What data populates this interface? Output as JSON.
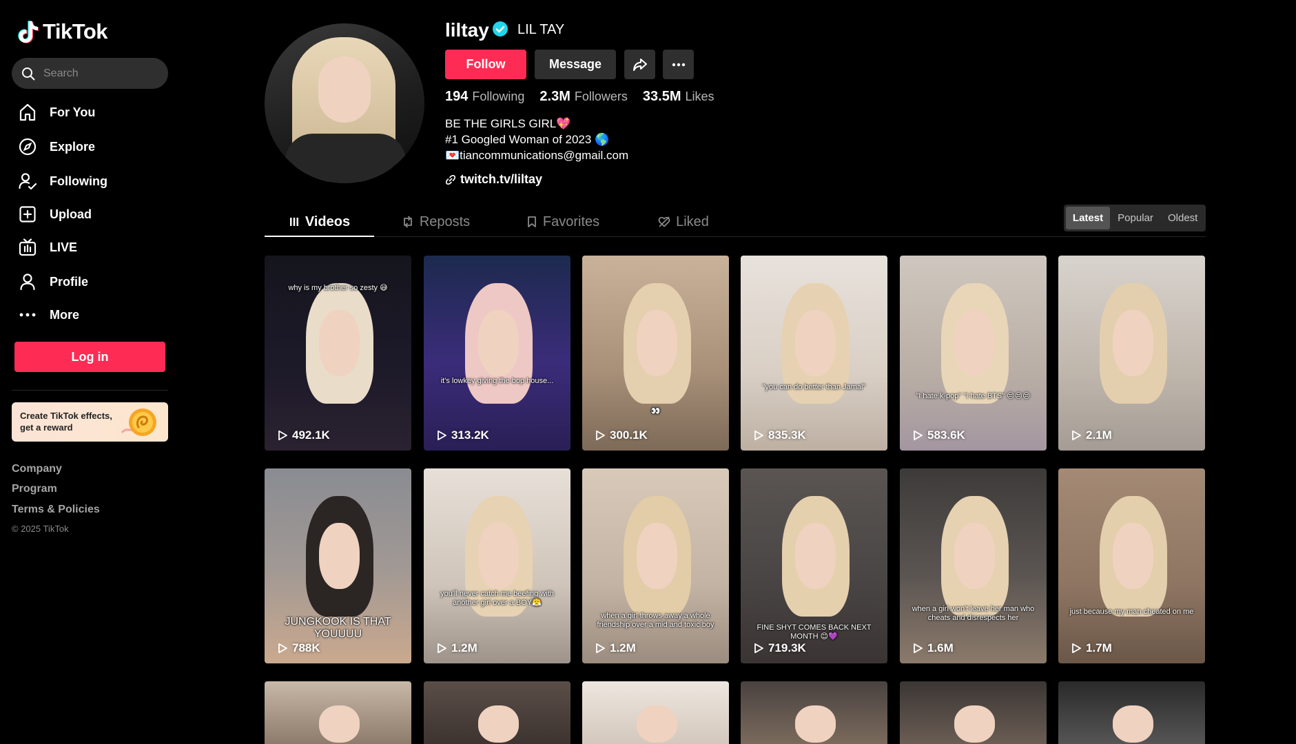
{
  "sidebar": {
    "logo_text": "TikTok",
    "search_placeholder": "Search",
    "nav": [
      {
        "label": "For You",
        "icon": "home-icon"
      },
      {
        "label": "Explore",
        "icon": "compass-icon"
      },
      {
        "label": "Following",
        "icon": "following-icon"
      },
      {
        "label": "Upload",
        "icon": "upload-icon"
      },
      {
        "label": "LIVE",
        "icon": "live-icon"
      },
      {
        "label": "Profile",
        "icon": "profile-icon"
      },
      {
        "label": "More",
        "icon": "more-icon"
      }
    ],
    "login_label": "Log in",
    "promo_text": "Create TikTok effects, get a reward",
    "footer_links": [
      "Company",
      "Program",
      "Terms & Policies"
    ],
    "copyright": "© 2025 TikTok"
  },
  "profile": {
    "username": "liltay",
    "nickname": "LIL TAY",
    "follow_label": "Follow",
    "message_label": "Message",
    "following_count": "194",
    "following_label": "Following",
    "followers_count": "2.3M",
    "followers_label": "Followers",
    "likes_count": "33.5M",
    "likes_label": "Likes",
    "bio": "BE THE GIRLS GIRL💖\n#1 Googled Woman of 2023 🌎\n💌tiancommunications@gmail.com",
    "link": "twitch.tv/liltay"
  },
  "tabs": [
    {
      "label": "Videos",
      "icon": "grid-icon"
    },
    {
      "label": "Reposts",
      "icon": "repost-icon"
    },
    {
      "label": "Favorites",
      "icon": "bookmark-icon"
    },
    {
      "label": "Liked",
      "icon": "liked-icon"
    }
  ],
  "sort": [
    "Latest",
    "Popular",
    "Oldest"
  ],
  "videos": [
    {
      "views": "492.1K",
      "caption": "why is my brother so zesty 😅"
    },
    {
      "views": "313.2K",
      "caption": "it's lowkey giving the bop house..."
    },
    {
      "views": "300.1K",
      "caption": "👀"
    },
    {
      "views": "835.3K",
      "caption": "\"you can do better than Jamal\""
    },
    {
      "views": "583.6K",
      "caption": "\"I hate k-pop\" \"I hate BTS\" 😒😒😒"
    },
    {
      "views": "2.1M",
      "caption": ""
    },
    {
      "views": "788K",
      "caption": "JUNGKOOK IS THAT YOUUUU"
    },
    {
      "views": "1.2M",
      "caption": "you'll never catch me beefing with another girl over a BOY😤"
    },
    {
      "views": "1.2M",
      "caption": "when a girl throws away a whole friendship over a mid and toxic boy"
    },
    {
      "views": "719.3K",
      "caption": "FINE SHYT COMES BACK NEXT MONTH 😊💜"
    },
    {
      "views": "1.6M",
      "caption": "when a girl won't leave her man who cheats and disrespects her"
    },
    {
      "views": "1.7M",
      "caption": "just because my man cheated on me"
    }
  ],
  "colors": {
    "accent": "#fe2c55",
    "verified": "#20d5ec"
  }
}
